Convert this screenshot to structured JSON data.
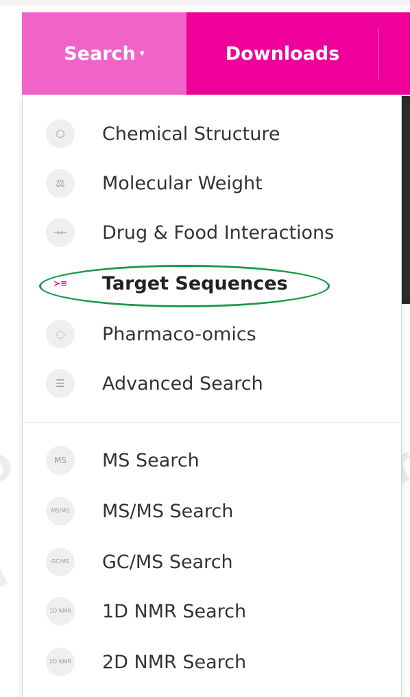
{
  "navbar": {
    "search_label": "Search",
    "search_caret": "▾",
    "downloads_label": "Downloads"
  },
  "dropdown": {
    "items": [
      {
        "label": "Chemical Structure",
        "icon": "hexagon-icon",
        "glyph": "⬡"
      },
      {
        "label": "Molecular Weight",
        "icon": "scale-icon",
        "glyph": "⚖"
      },
      {
        "label": "Drug & Food Interactions",
        "icon": "arrows-converge-icon",
        "glyph": "→←"
      },
      {
        "label": "Target Sequences",
        "icon": "sequence-icon",
        "glyph": "≻≡",
        "active": true
      },
      {
        "label": "Pharmaco-omics",
        "icon": "circle-arrows-icon",
        "glyph": "◌"
      },
      {
        "label": "Advanced Search",
        "icon": "sliders-icon",
        "glyph": "☰"
      }
    ],
    "spectra_items": [
      {
        "label": "MS Search",
        "icon": "ms-icon",
        "glyph": "MS"
      },
      {
        "label": "MS/MS Search",
        "icon": "msms-icon",
        "glyph": "MS/MS"
      },
      {
        "label": "GC/MS Search",
        "icon": "gcms-icon",
        "glyph": "GC/MS"
      },
      {
        "label": "1D NMR Search",
        "icon": "1d-nmr-icon",
        "glyph": "1D NMR"
      },
      {
        "label": "2D NMR Search",
        "icon": "2d-nmr-icon",
        "glyph": "2D NMR"
      }
    ]
  },
  "colors": {
    "navbar": "#f0009a",
    "search_active": "#f163c9",
    "highlight": "#169a4a"
  }
}
